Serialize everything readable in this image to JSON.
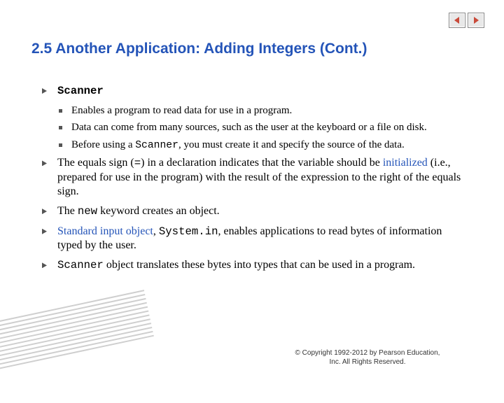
{
  "title": "2.5  Another Application: Adding Integers (Cont.)",
  "bullets": {
    "b1": "Scanner",
    "b1_1": "Enables a program to read data for use in a program.",
    "b1_2": "Data can come from many sources, such as the user at the keyboard or a file on disk.",
    "b1_3a": "Before using a ",
    "b1_3b": "Scanner",
    "b1_3c": ", you must create it and specify the source of the data.",
    "b2a": "The equals sign (",
    "b2b": "=",
    "b2c": ") in a declaration indicates that the variable should be ",
    "b2d": "initialized",
    "b2e": " (i.e., prepared for use in the program) with the result of the expression to the right of the equals sign.",
    "b3a": "The ",
    "b3b": "new",
    "b3c": " keyword creates an object.",
    "b4a": "Standard input object",
    "b4b": ", ",
    "b4c": "System.in",
    "b4d": ", enables applications to read bytes of information typed by the user.",
    "b5a": "Scanner",
    "b5b": " object translates these bytes into types that can be used in a program."
  },
  "copyright": "© Copyright 1992-2012 by Pearson Education, Inc. All Rights Reserved."
}
